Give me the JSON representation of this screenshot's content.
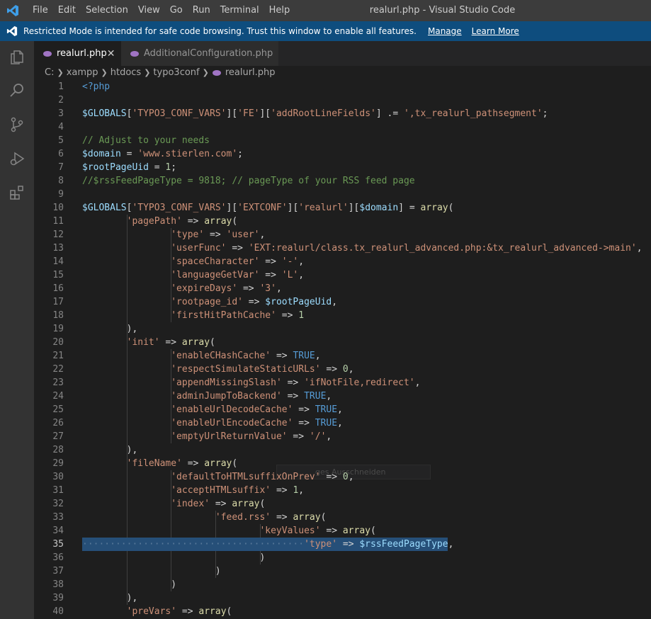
{
  "titlebar": {
    "menu": [
      "File",
      "Edit",
      "Selection",
      "View",
      "Go",
      "Run",
      "Terminal",
      "Help"
    ],
    "window_title": "realurl.php - Visual Studio Code"
  },
  "banner": {
    "message": "Restricted Mode is intended for safe code browsing. Trust this window to enable all features.",
    "manage": "Manage",
    "learn_more": "Learn More"
  },
  "tabs": [
    {
      "label": "realurl.php",
      "active": true,
      "close": "✕"
    },
    {
      "label": "AdditionalConfiguration.php",
      "active": false
    }
  ],
  "breadcrumbs": [
    "C:",
    "xampp",
    "htdocs",
    "typo3conf",
    "realurl.php"
  ],
  "ghost_hint": "ges Ausschneiden",
  "editor": {
    "current_line": 35,
    "lines": [
      {
        "n": "1",
        "t": [
          [
            "tag",
            "<?php"
          ]
        ]
      },
      {
        "n": "2",
        "t": []
      },
      {
        "n": "3",
        "t": [
          [
            "var",
            "$GLOBALS"
          ],
          [
            "",
            "["
          ],
          [
            "str",
            "'TYPO3_CONF_VARS'"
          ],
          [
            "",
            "]["
          ],
          [
            "str",
            "'FE'"
          ],
          [
            "",
            "]["
          ],
          [
            "str",
            "'addRootLineFields'"
          ],
          [
            "",
            "] .= "
          ],
          [
            "str",
            "',tx_realurl_pathsegment'"
          ],
          [
            "",
            ";"
          ]
        ]
      },
      {
        "n": "4",
        "t": []
      },
      {
        "n": "5",
        "t": [
          [
            "cmt",
            "// Adjust to your needs"
          ]
        ]
      },
      {
        "n": "6",
        "t": [
          [
            "var",
            "$domain"
          ],
          [
            "",
            " = "
          ],
          [
            "str",
            "'www.stierlen.com'"
          ],
          [
            "",
            ";"
          ]
        ]
      },
      {
        "n": "7",
        "t": [
          [
            "var",
            "$rootPageUid"
          ],
          [
            "",
            " = "
          ],
          [
            "num",
            "1"
          ],
          [
            "",
            ";"
          ]
        ]
      },
      {
        "n": "8",
        "t": [
          [
            "cmt",
            "//$rssFeedPageType = 9818; // pageType of your RSS feed page"
          ]
        ]
      },
      {
        "n": "9",
        "t": []
      },
      {
        "n": "10",
        "t": [
          [
            "var",
            "$GLOBALS"
          ],
          [
            "",
            "["
          ],
          [
            "str",
            "'TYPO3_CONF_VARS'"
          ],
          [
            "",
            "]["
          ],
          [
            "str",
            "'EXTCONF'"
          ],
          [
            "",
            "]["
          ],
          [
            "str",
            "'realurl'"
          ],
          [
            "",
            "]["
          ],
          [
            "var",
            "$domain"
          ],
          [
            "",
            "] = "
          ],
          [
            "fn",
            "array"
          ],
          [
            "",
            "("
          ]
        ]
      },
      {
        "n": "11",
        "t": [
          [
            "",
            "        "
          ],
          [
            "str",
            "'pagePath'"
          ],
          [
            "",
            " => "
          ],
          [
            "fn",
            "array"
          ],
          [
            "",
            "("
          ]
        ]
      },
      {
        "n": "12",
        "t": [
          [
            "",
            "                "
          ],
          [
            "str",
            "'type'"
          ],
          [
            "",
            " => "
          ],
          [
            "str",
            "'user'"
          ],
          [
            "",
            ","
          ]
        ]
      },
      {
        "n": "13",
        "t": [
          [
            "",
            "                "
          ],
          [
            "str",
            "'userFunc'"
          ],
          [
            "",
            " => "
          ],
          [
            "str",
            "'EXT:realurl/class.tx_realurl_advanced.php:&tx_realurl_advanced->main'"
          ],
          [
            "",
            ","
          ]
        ]
      },
      {
        "n": "14",
        "t": [
          [
            "",
            "                "
          ],
          [
            "str",
            "'spaceCharacter'"
          ],
          [
            "",
            " => "
          ],
          [
            "str",
            "'-'"
          ],
          [
            "",
            ","
          ]
        ]
      },
      {
        "n": "15",
        "t": [
          [
            "",
            "                "
          ],
          [
            "str",
            "'languageGetVar'"
          ],
          [
            "",
            " => "
          ],
          [
            "str",
            "'L'"
          ],
          [
            "",
            ","
          ]
        ]
      },
      {
        "n": "16",
        "t": [
          [
            "",
            "                "
          ],
          [
            "str",
            "'expireDays'"
          ],
          [
            "",
            " => "
          ],
          [
            "str",
            "'3'"
          ],
          [
            "",
            ","
          ]
        ]
      },
      {
        "n": "17",
        "t": [
          [
            "",
            "                "
          ],
          [
            "str",
            "'rootpage_id'"
          ],
          [
            "",
            " => "
          ],
          [
            "var",
            "$rootPageUid"
          ],
          [
            "",
            ","
          ]
        ]
      },
      {
        "n": "18",
        "t": [
          [
            "",
            "                "
          ],
          [
            "str",
            "'firstHitPathCache'"
          ],
          [
            "",
            " => "
          ],
          [
            "num",
            "1"
          ]
        ]
      },
      {
        "n": "19",
        "t": [
          [
            "",
            "        ),"
          ]
        ]
      },
      {
        "n": "20",
        "t": [
          [
            "",
            "        "
          ],
          [
            "str",
            "'init'"
          ],
          [
            "",
            " => "
          ],
          [
            "fn",
            "array"
          ],
          [
            "",
            "("
          ]
        ]
      },
      {
        "n": "21",
        "t": [
          [
            "",
            "                "
          ],
          [
            "str",
            "'enableCHashCache'"
          ],
          [
            "",
            " => "
          ],
          [
            "kw",
            "TRUE"
          ],
          [
            "",
            ","
          ]
        ]
      },
      {
        "n": "22",
        "t": [
          [
            "",
            "                "
          ],
          [
            "str",
            "'respectSimulateStaticURLs'"
          ],
          [
            "",
            " => "
          ],
          [
            "num",
            "0"
          ],
          [
            "",
            ","
          ]
        ]
      },
      {
        "n": "23",
        "t": [
          [
            "",
            "                "
          ],
          [
            "str",
            "'appendMissingSlash'"
          ],
          [
            "",
            " => "
          ],
          [
            "str",
            "'ifNotFile,redirect'"
          ],
          [
            "",
            ","
          ]
        ]
      },
      {
        "n": "24",
        "t": [
          [
            "",
            "                "
          ],
          [
            "str",
            "'adminJumpToBackend'"
          ],
          [
            "",
            " => "
          ],
          [
            "kw",
            "TRUE"
          ],
          [
            "",
            ","
          ]
        ]
      },
      {
        "n": "25",
        "t": [
          [
            "",
            "                "
          ],
          [
            "str",
            "'enableUrlDecodeCache'"
          ],
          [
            "",
            " => "
          ],
          [
            "kw",
            "TRUE"
          ],
          [
            "",
            ","
          ]
        ]
      },
      {
        "n": "26",
        "t": [
          [
            "",
            "                "
          ],
          [
            "str",
            "'enableUrlEncodeCache'"
          ],
          [
            "",
            " => "
          ],
          [
            "kw",
            "TRUE"
          ],
          [
            "",
            ","
          ]
        ]
      },
      {
        "n": "27",
        "t": [
          [
            "",
            "                "
          ],
          [
            "str",
            "'emptyUrlReturnValue'"
          ],
          [
            "",
            " => "
          ],
          [
            "str",
            "'/'"
          ],
          [
            "",
            ","
          ]
        ]
      },
      {
        "n": "28",
        "t": [
          [
            "",
            "        ),"
          ]
        ]
      },
      {
        "n": "29",
        "t": [
          [
            "",
            "        "
          ],
          [
            "str",
            "'fileName'"
          ],
          [
            "",
            " => "
          ],
          [
            "fn",
            "array"
          ],
          [
            "",
            "("
          ]
        ]
      },
      {
        "n": "30",
        "t": [
          [
            "",
            "                "
          ],
          [
            "str",
            "'defaultToHTMLsuffixOnPrev'"
          ],
          [
            "",
            " => "
          ],
          [
            "num",
            "0"
          ],
          [
            "",
            ","
          ]
        ]
      },
      {
        "n": "31",
        "t": [
          [
            "",
            "                "
          ],
          [
            "str",
            "'acceptHTMLsuffix'"
          ],
          [
            "",
            " => "
          ],
          [
            "num",
            "1"
          ],
          [
            "",
            ","
          ]
        ]
      },
      {
        "n": "32",
        "t": [
          [
            "",
            "                "
          ],
          [
            "str",
            "'index'"
          ],
          [
            "",
            " => "
          ],
          [
            "fn",
            "array"
          ],
          [
            "",
            "("
          ]
        ]
      },
      {
        "n": "33",
        "t": [
          [
            "",
            "                        "
          ],
          [
            "str",
            "'feed.rss'"
          ],
          [
            "",
            " => "
          ],
          [
            "fn",
            "array"
          ],
          [
            "",
            "("
          ]
        ]
      },
      {
        "n": "34",
        "t": [
          [
            "",
            "                                "
          ],
          [
            "str",
            "'keyValues'"
          ],
          [
            "",
            " => "
          ],
          [
            "fn",
            "array"
          ],
          [
            "",
            "("
          ]
        ]
      },
      {
        "n": "35",
        "t": [
          [
            "",
            "········································"
          ],
          [
            "str",
            "'type'"
          ],
          [
            "",
            " => "
          ],
          [
            "var",
            "$rssFeedPageType"
          ],
          [
            "",
            ","
          ]
        ]
      },
      {
        "n": "36",
        "t": [
          [
            "",
            "                                )"
          ]
        ]
      },
      {
        "n": "37",
        "t": [
          [
            "",
            "                        )"
          ]
        ]
      },
      {
        "n": "38",
        "t": [
          [
            "",
            "                )"
          ]
        ]
      },
      {
        "n": "39",
        "t": [
          [
            "",
            "        ),"
          ]
        ]
      },
      {
        "n": "40",
        "t": [
          [
            "",
            "        "
          ],
          [
            "str",
            "'preVars'"
          ],
          [
            "",
            " => "
          ],
          [
            "fn",
            "array"
          ],
          [
            "",
            "("
          ]
        ]
      }
    ]
  }
}
